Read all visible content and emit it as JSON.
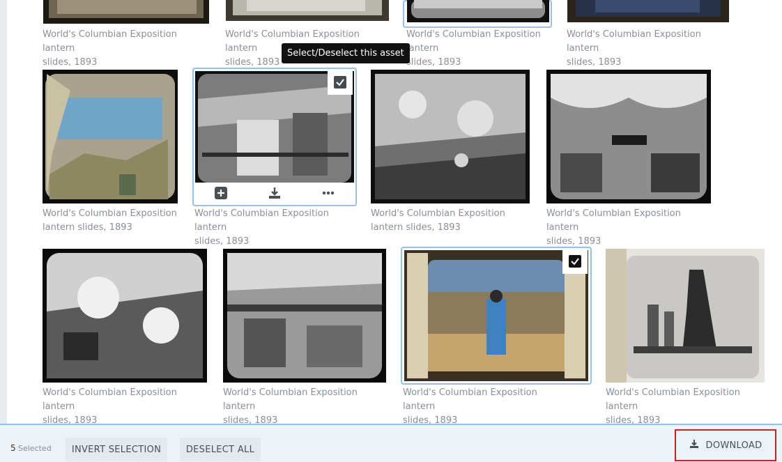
{
  "tooltip": "Select/Deselect this asset",
  "rows": {
    "top": [
      {
        "line1": "World's Columbian Exposition lantern",
        "line2": "slides, 1893"
      },
      {
        "line1": "World's Columbian Exposition lantern",
        "line2": "slides, 1893"
      },
      {
        "line1": "World's Columbian Exposition lantern",
        "line2": "slides, 1893"
      },
      {
        "line1": "World's Columbian Exposition lantern",
        "line2": "slides, 1893"
      }
    ],
    "middle": [
      {
        "line1": "World's Columbian Exposition",
        "line2": "lantern slides, 1893"
      },
      {
        "line1": "World's Columbian Exposition lantern",
        "line2": "slides, 1893",
        "selected": true
      },
      {
        "line1": "World's Columbian Exposition",
        "line2": "lantern slides, 1893"
      },
      {
        "line1": "World's Columbian Exposition lantern",
        "line2": "slides, 1893"
      }
    ],
    "bottom": [
      {
        "line1": "World's Columbian Exposition lantern",
        "line2": "slides, 1893"
      },
      {
        "line1": "World's Columbian Exposition lantern",
        "line2": "slides, 1893"
      },
      {
        "line1": "World's Columbian Exposition lantern",
        "line2": "slides, 1893",
        "selected": true
      },
      {
        "line1": "World's Columbian Exposition lantern",
        "line2": "slides, 1893"
      }
    ]
  },
  "hover_actions": [
    "add-icon",
    "download-icon",
    "more-icon"
  ],
  "footer": {
    "selected_count": "5",
    "selected_label": "Selected",
    "invert_label": "INVERT SELECTION",
    "deselect_label": "DESELECT ALL",
    "download_label": "DOWNLOAD"
  },
  "colors": {
    "accent": "#8fc2ec",
    "highlight": "#d9192a",
    "caption": "#8a8f96",
    "footer_bg": "#edf2f7"
  }
}
